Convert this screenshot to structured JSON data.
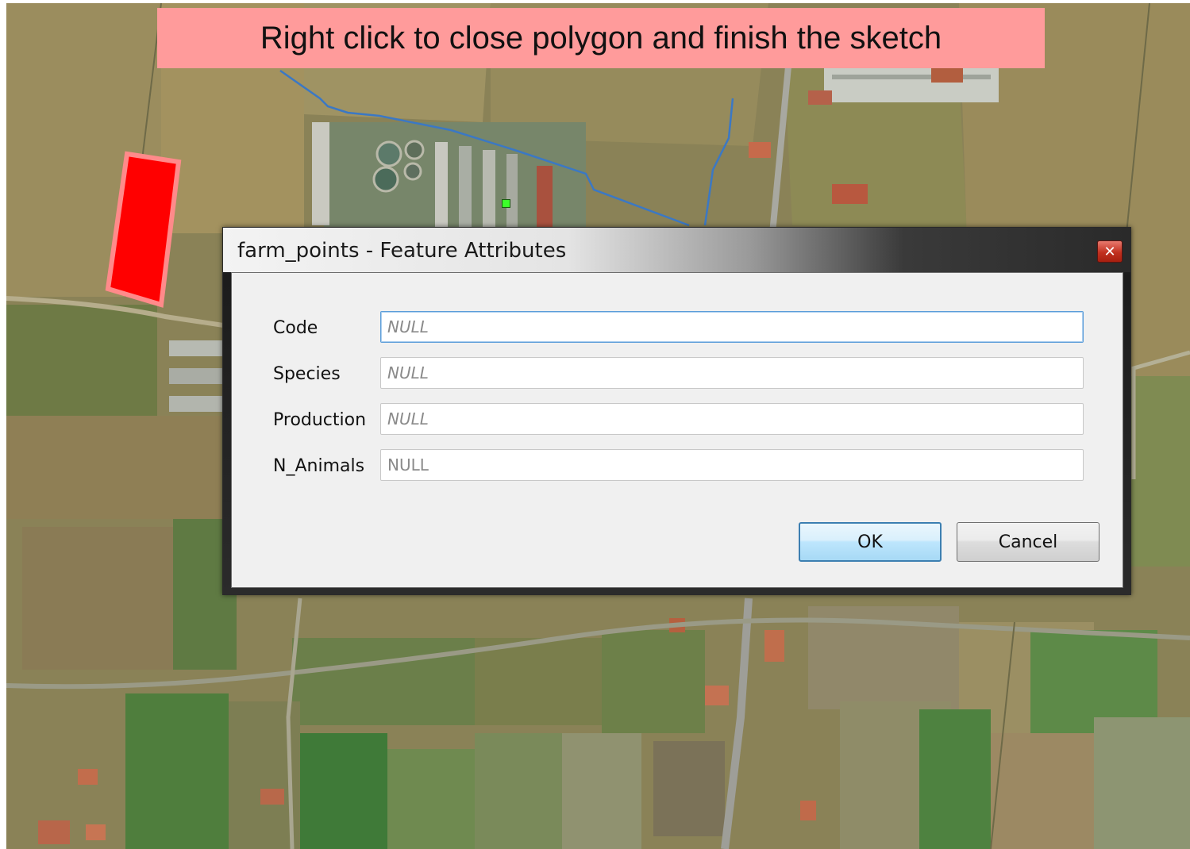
{
  "banner": {
    "text": "Right click to close polygon and finish the sketch"
  },
  "dialog": {
    "title": "farm_points - Feature Attributes",
    "close_icon": "close-icon",
    "fields": [
      {
        "label": "Code",
        "value": "NULL"
      },
      {
        "label": "Species",
        "value": "NULL"
      },
      {
        "label": "Production",
        "value": "NULL"
      },
      {
        "label": "N_Animals",
        "value": "NULL"
      }
    ],
    "ok_label": "OK",
    "cancel_label": "Cancel"
  },
  "colors": {
    "banner": "#ff9b9b",
    "sketch_fill": "#ff0000",
    "sketch_outline": "#ff8a8a",
    "vertex": "#3cff2a",
    "waterway": "#3b78c4"
  }
}
